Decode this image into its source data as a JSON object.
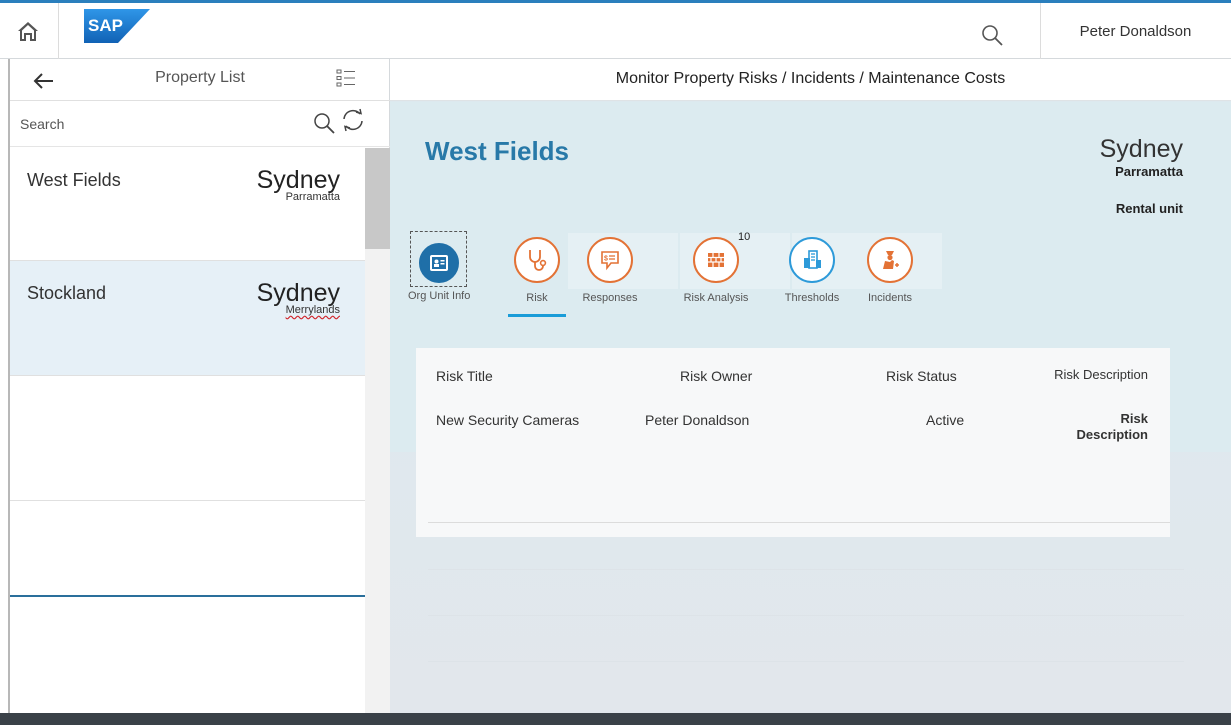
{
  "shell": {
    "logo_text": "SAP",
    "user_name": "Peter Donaldson",
    "colors": {
      "accent": "#2a7fbd",
      "logo": "#1877c9"
    }
  },
  "master": {
    "title": "Property List",
    "search_placeholder": "Search",
    "items": [
      {
        "name": "West Fields",
        "city": "Sydney",
        "suburb": "Parramatta"
      },
      {
        "name": "Stockland",
        "city": "Sydney",
        "suburb": "Merrylands"
      }
    ]
  },
  "detail": {
    "page_title": "Monitor Property Risks / Incidents / Maintenance Costs",
    "object": {
      "title": "West Fields",
      "city": "Sydney",
      "suburb": "Parramatta",
      "attribute": "Rental unit"
    },
    "tabs": [
      {
        "label": "Org Unit Info",
        "icon": "id-card-icon"
      },
      {
        "label": "Risk",
        "icon": "stethoscope-icon"
      },
      {
        "label": "Responses",
        "icon": "chat-money-icon"
      },
      {
        "label": "Risk Analysis",
        "icon": "brick-wall-icon",
        "count": "10"
      },
      {
        "label": "Thresholds",
        "icon": "buildings-icon"
      },
      {
        "label": "Incidents",
        "icon": "injured-person-icon"
      }
    ],
    "risk_table": {
      "columns": [
        "Risk Title",
        "Risk Owner",
        "Risk Status",
        "Risk Description"
      ],
      "rows": [
        {
          "title": "New Security Cameras",
          "owner": "Peter Donaldson",
          "status": "Active",
          "description": "Risk Description"
        }
      ]
    }
  }
}
